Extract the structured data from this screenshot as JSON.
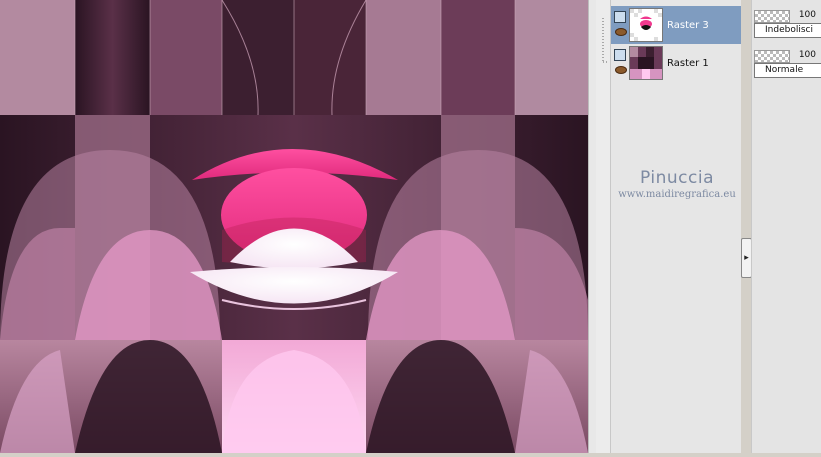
{
  "layers": [
    {
      "name": "Raster 3",
      "selected": true,
      "opacity": "100",
      "blend_mode": "Indebolisci"
    },
    {
      "name": "Raster 1",
      "selected": false,
      "opacity": "100",
      "blend_mode": "Normale"
    }
  ],
  "watermark": {
    "name": "Pinuccia",
    "url": "www.maidiregrafica.eu"
  },
  "colors": {
    "selected_row": "#7f9cc0",
    "panel_bg": "#e6e6e6",
    "hot_pink": "#f0388e",
    "dark_plum": "#2a1422",
    "mauve": "#9a6a85"
  },
  "icons": [
    "layer-type-icon",
    "eye-icon",
    "collapse-arrow-icon"
  ]
}
